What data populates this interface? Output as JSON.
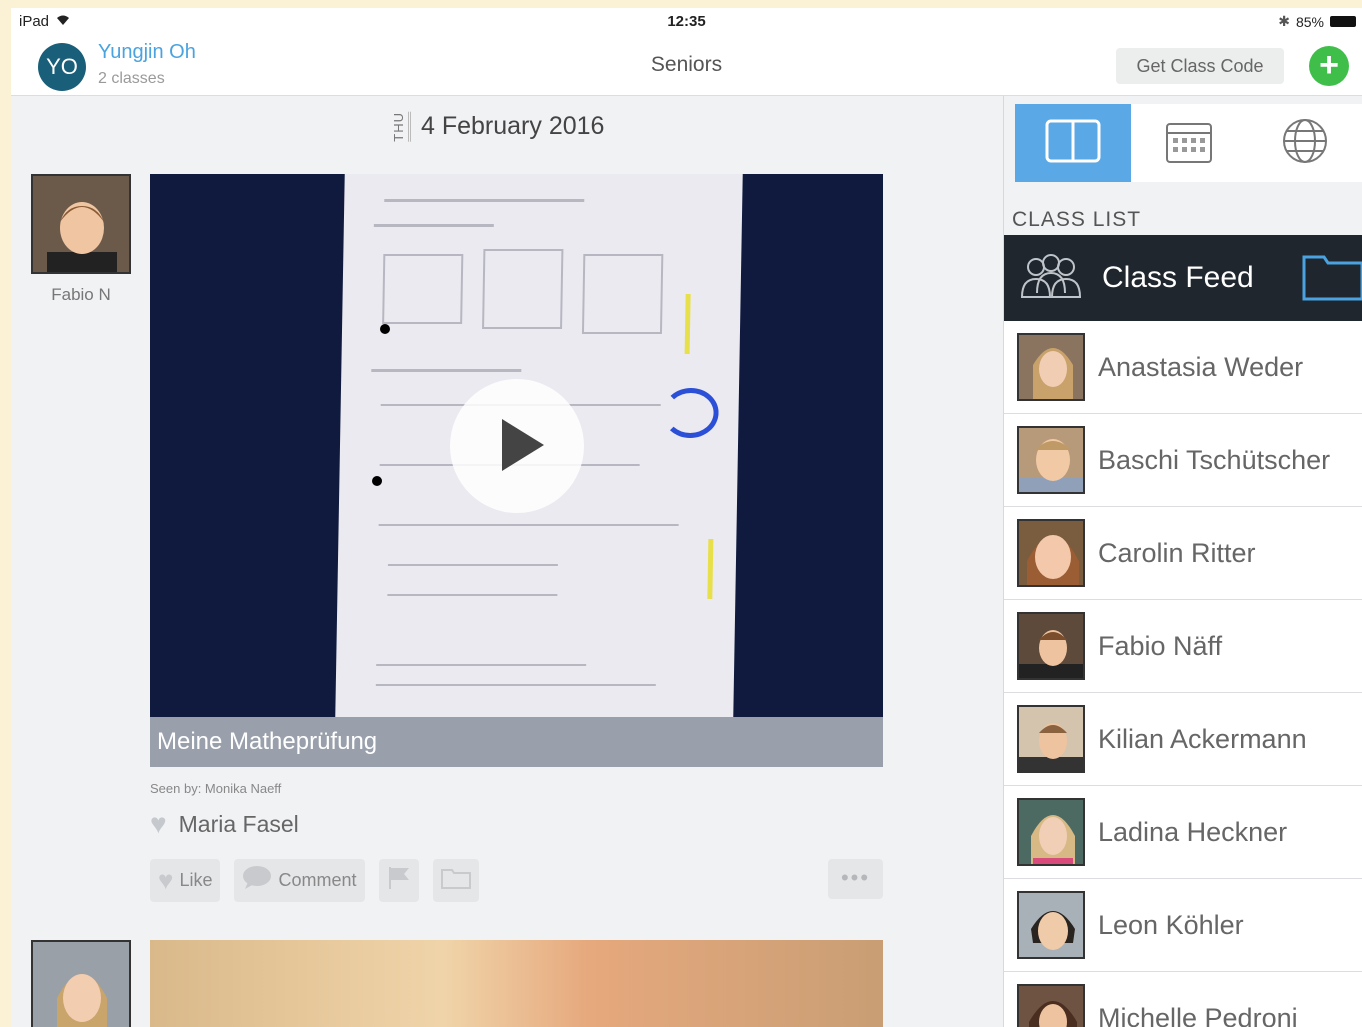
{
  "status_bar": {
    "device": "iPad",
    "time": "12:35",
    "battery": "85%"
  },
  "header": {
    "user_initials": "YO",
    "user_name": "Yungjin Oh",
    "user_classes": "2 classes",
    "title": "Seniors",
    "class_code_label": "Get Class Code",
    "add_label": "+"
  },
  "feed": {
    "day_of_week": "THU",
    "date": "4 February 2016",
    "post": {
      "author": "Fabio N",
      "caption": "Meine Matheprüfung",
      "seen_by": "Seen by: Monika Naeff",
      "liked_by": "Maria Fasel",
      "like_label": "Like",
      "comment_label": "Comment",
      "more_label": "•••"
    }
  },
  "sidebar": {
    "class_list_label": "CLASS LIST",
    "class_feed_label": "Class Feed",
    "students": [
      {
        "name": "Anastasia Weder"
      },
      {
        "name": "Baschi Tschütscher"
      },
      {
        "name": "Carolin Ritter"
      },
      {
        "name": "Fabio Näff"
      },
      {
        "name": "Kilian Ackermann"
      },
      {
        "name": "Ladina Heckner"
      },
      {
        "name": "Leon Köhler"
      },
      {
        "name": "Michelle Pedroni"
      }
    ]
  },
  "colors": {
    "accent": "#4aa3e0",
    "tab_active": "#5aa8e6",
    "add_button": "#3fbf4a",
    "class_feed_bg": "#1f262d"
  }
}
